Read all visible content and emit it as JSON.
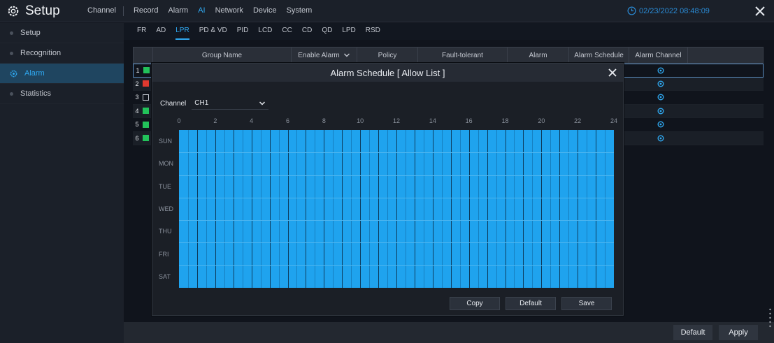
{
  "app": {
    "title": "Setup"
  },
  "topnav": {
    "items": [
      {
        "label": "Channel",
        "active": false
      },
      {
        "label": "Record",
        "active": false
      },
      {
        "label": "Alarm",
        "active": false
      },
      {
        "label": "AI",
        "active": true
      },
      {
        "label": "Network",
        "active": false
      },
      {
        "label": "Device",
        "active": false
      },
      {
        "label": "System",
        "active": false
      }
    ],
    "datetime": "02/23/2022 08:48:09"
  },
  "sidebar": {
    "items": [
      {
        "label": "Setup",
        "active": false
      },
      {
        "label": "Recognition",
        "active": false
      },
      {
        "label": "Alarm",
        "active": true
      },
      {
        "label": "Statistics",
        "active": false
      }
    ]
  },
  "subtabs": [
    {
      "label": "FR",
      "active": false
    },
    {
      "label": "AD",
      "active": false
    },
    {
      "label": "LPR",
      "active": true
    },
    {
      "label": "PD & VD",
      "active": false
    },
    {
      "label": "PID",
      "active": false
    },
    {
      "label": "LCD",
      "active": false
    },
    {
      "label": "CC",
      "active": false
    },
    {
      "label": "CD",
      "active": false
    },
    {
      "label": "QD",
      "active": false
    },
    {
      "label": "LPD",
      "active": false
    },
    {
      "label": "RSD",
      "active": false
    }
  ],
  "table": {
    "headers": [
      "Group Name",
      "Enable Alarm",
      "Policy",
      "Fault-tolerant",
      "Alarm",
      "Alarm Schedule",
      "Alarm Channel"
    ],
    "rows": [
      {
        "num": "1",
        "color": "#22c25a"
      },
      {
        "num": "2",
        "color": "#e0392f"
      },
      {
        "num": "3",
        "color": "none"
      },
      {
        "num": "4",
        "color": "#22c25a"
      },
      {
        "num": "5",
        "color": "#22c25a"
      },
      {
        "num": "6",
        "color": "#22c25a"
      }
    ]
  },
  "modal": {
    "title": "Alarm Schedule [ Allow List ]",
    "channel_label": "Channel",
    "channel_value": "CH1",
    "hours": [
      "0",
      "2",
      "4",
      "6",
      "8",
      "10",
      "12",
      "14",
      "16",
      "18",
      "20",
      "22",
      "24"
    ],
    "days": [
      "SUN",
      "MON",
      "TUE",
      "WED",
      "THU",
      "FRI",
      "SAT"
    ],
    "buttons": {
      "copy": "Copy",
      "default": "Default",
      "save": "Save"
    }
  },
  "footer": {
    "default": "Default",
    "apply": "Apply"
  },
  "colors": {
    "accent": "#2fa8f0",
    "schedule_fill": "#1fa3ee"
  }
}
